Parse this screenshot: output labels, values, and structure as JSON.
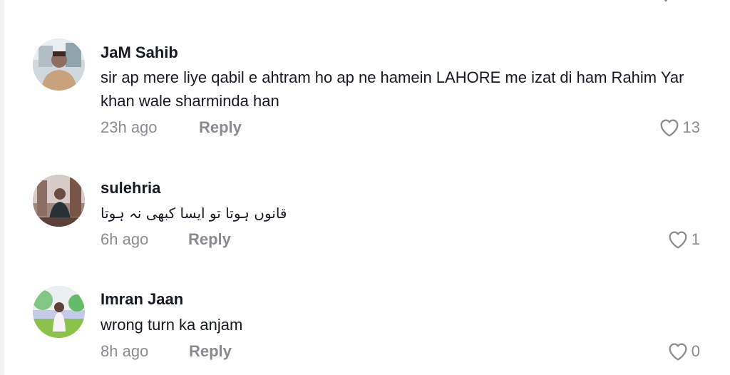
{
  "clipped_previous": {
    "partial_text": "~ ~ ~ ~ ~ ~ ~"
  },
  "comments": [
    {
      "username": "JaM Sahib",
      "text": "sir ap mere liye qabil e ahtram ho ap ne hamein LAHORE me izat di ham Rahim Yar khan wale sharminda han",
      "time": "23h ago",
      "reply_label": "Reply",
      "likes": "13",
      "avatar_icon": "profile-photo"
    },
    {
      "username": "sulehria",
      "text": "قانوں ہوتا تو ایسا کبھی نہ ہوتا",
      "time": "6h ago",
      "reply_label": "Reply",
      "likes": "1",
      "avatar_icon": "profile-photo"
    },
    {
      "username": "Imran Jaan",
      "text": "wrong turn ka anjam",
      "time": "8h ago",
      "reply_label": "Reply",
      "likes": "0",
      "avatar_icon": "profile-photo"
    }
  ],
  "colors": {
    "primary_text": "#161823",
    "secondary_text": "#8a8b91",
    "background": "#ffffff"
  }
}
